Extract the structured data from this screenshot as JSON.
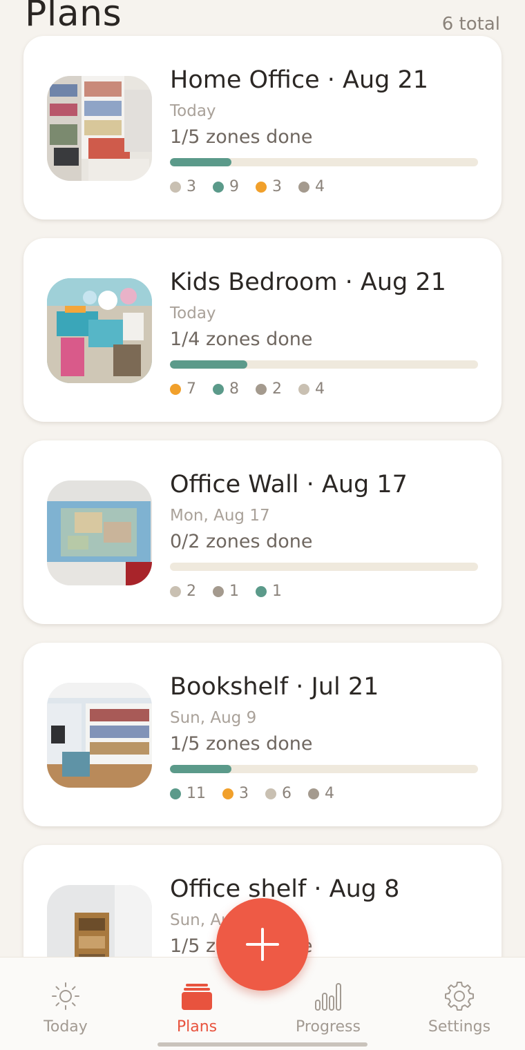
{
  "header": {
    "title": "Plans",
    "count": "6 total"
  },
  "colors": {
    "accent": "#ee5a45",
    "progress": "#5b9a8a",
    "dot_teal": "#5b9a8a",
    "dot_orange": "#f1a02b",
    "dot_beige": "#c9c0b2",
    "dot_taupe": "#a49a8e"
  },
  "plans": [
    {
      "title": "Home Office · Aug 21",
      "subtitle": "Today",
      "zones": "1/5 zones done",
      "progress": 0.2,
      "photo": "home-office-photo",
      "stats": [
        {
          "color": "beige",
          "value": "3"
        },
        {
          "color": "teal",
          "value": "9"
        },
        {
          "color": "orange",
          "value": "3"
        },
        {
          "color": "taupe",
          "value": "4"
        }
      ]
    },
    {
      "title": "Kids Bedroom · Aug 21",
      "subtitle": "Today",
      "zones": "1/4 zones done",
      "progress": 0.25,
      "photo": "kids-bedroom-photo",
      "stats": [
        {
          "color": "orange",
          "value": "7"
        },
        {
          "color": "teal",
          "value": "8"
        },
        {
          "color": "taupe",
          "value": "2"
        },
        {
          "color": "beige",
          "value": "4"
        }
      ]
    },
    {
      "title": "Office Wall · Aug 17",
      "subtitle": "Mon, Aug 17",
      "zones": "0/2 zones done",
      "progress": 0,
      "photo": "office-wall-photo",
      "stats": [
        {
          "color": "beige",
          "value": "2"
        },
        {
          "color": "taupe",
          "value": "1"
        },
        {
          "color": "teal",
          "value": "1"
        }
      ]
    },
    {
      "title": "Bookshelf · Jul 21",
      "subtitle": "Sun, Aug 9",
      "zones": "1/5 zones done",
      "progress": 0.2,
      "photo": "bookshelf-photo",
      "stats": [
        {
          "color": "teal",
          "value": "11"
        },
        {
          "color": "orange",
          "value": "3"
        },
        {
          "color": "beige",
          "value": "6"
        },
        {
          "color": "taupe",
          "value": "4"
        }
      ]
    },
    {
      "title": "Office shelf · Aug 8",
      "subtitle": "Sun, Aug 9",
      "zones": "1/5 zones done",
      "progress": 0.2,
      "photo": "office-shelf-photo",
      "stats": []
    }
  ],
  "fab": {
    "icon": "plus-icon"
  },
  "nav": {
    "items": [
      {
        "label": "Today",
        "icon": "sun-icon"
      },
      {
        "label": "Plans",
        "icon": "plans-stack-icon",
        "active": true
      },
      {
        "label": "Progress",
        "icon": "bar-chart-icon"
      },
      {
        "label": "Settings",
        "icon": "gear-icon"
      }
    ]
  }
}
